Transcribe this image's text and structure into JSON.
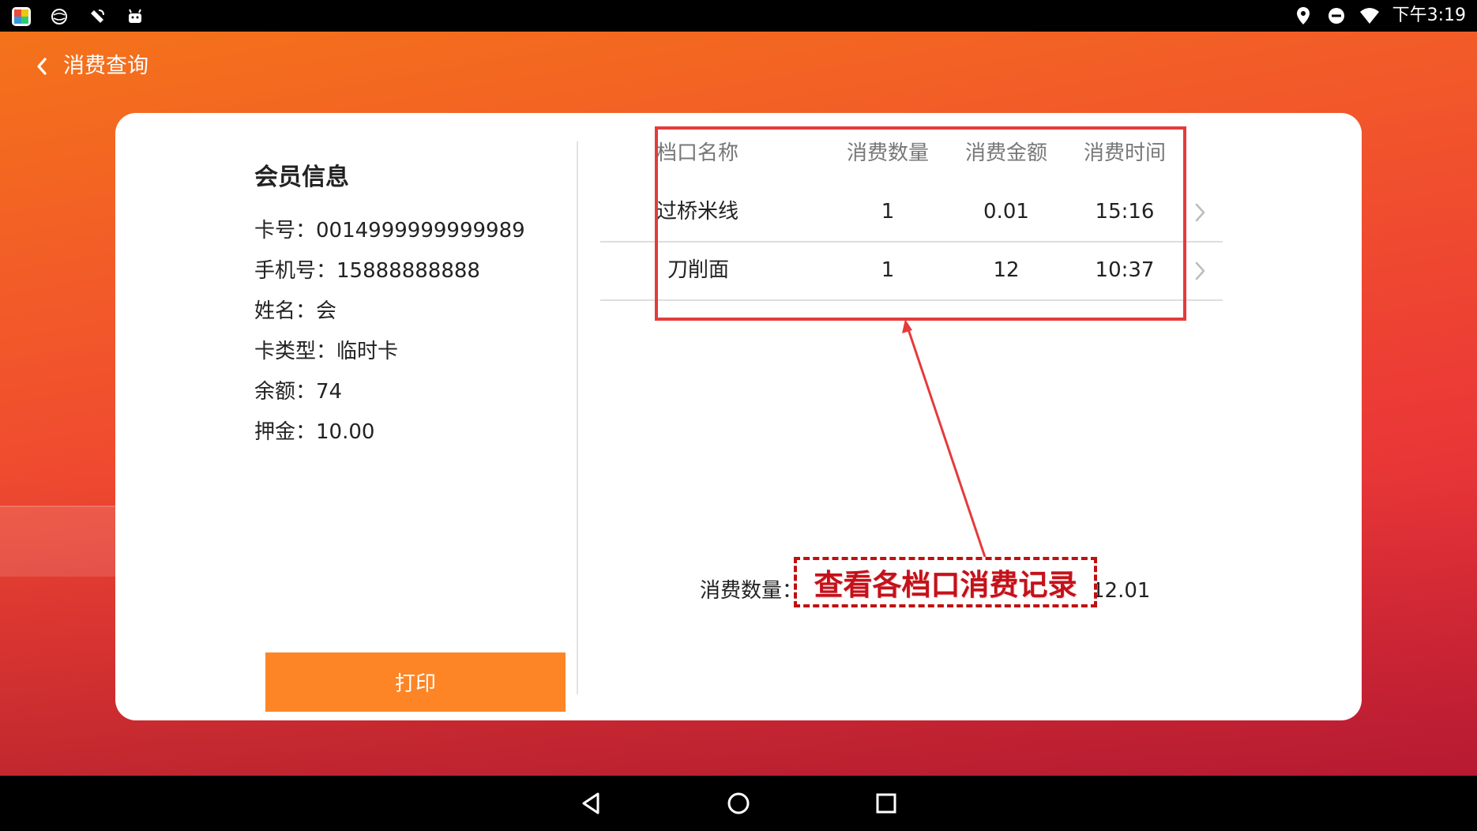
{
  "status_bar": {
    "time": "下午3:19",
    "left_icons": [
      "gallery-app-icon",
      "browser-icon",
      "satellite-icon",
      "android-icon"
    ],
    "right_icons": [
      "location-icon",
      "do-not-disturb-icon",
      "wifi-icon"
    ]
  },
  "header": {
    "title": "消费查询"
  },
  "member": {
    "title": "会员信息",
    "card_no": "卡号：0014999999999989",
    "phone": "手机号：15888888888",
    "name": "姓名：会",
    "card_type": "卡类型：临时卡",
    "balance": "余额：74",
    "deposit": "押金：10.00"
  },
  "print_label": "打印",
  "table": {
    "headers": {
      "name": "档口名称",
      "qty": "消费数量",
      "amount": "消费金额",
      "time": "消费时间"
    },
    "rows": [
      {
        "name": "过桥米线",
        "qty": "1",
        "amount": "0.01",
        "time": "15:16"
      },
      {
        "name": "刀削面",
        "qty": "1",
        "amount": "12",
        "time": "10:37"
      }
    ]
  },
  "summary": {
    "total_qty": "消费数量：2",
    "total_amount": "消费金额：12.01"
  },
  "annotation": {
    "label": "查看各档口消费记录",
    "color": "#e53b3b"
  },
  "colors": {
    "accent": "#fd8526",
    "gradient_start": "#f4731a",
    "gradient_end": "#d51f3c"
  }
}
